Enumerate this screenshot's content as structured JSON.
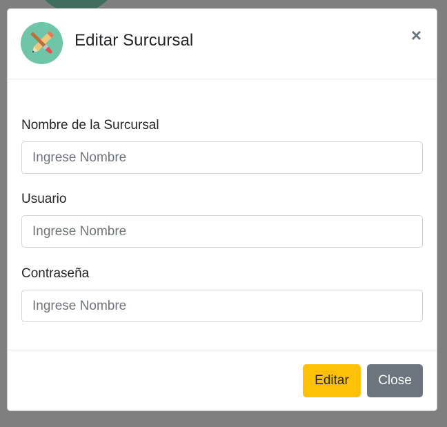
{
  "modal": {
    "title": "Editar Surcursal",
    "icon": "pencil-brush-crossed-icon",
    "close_symbol": "×"
  },
  "fields": [
    {
      "label": "Nombre de la Surcursal",
      "placeholder": "Ingrese Nombre",
      "value": ""
    },
    {
      "label": "Usuario",
      "placeholder": "Ingrese Nombre",
      "value": ""
    },
    {
      "label": "Contraseña",
      "placeholder": "Ingrese Nombre",
      "value": ""
    }
  ],
  "footer": {
    "edit_label": "Editar",
    "close_label": "Close"
  },
  "colors": {
    "backdrop": "#7f7f7f",
    "edit_button": "#ffc107",
    "close_button": "#6c757d",
    "avatar_bg": "#6fc5a8"
  }
}
